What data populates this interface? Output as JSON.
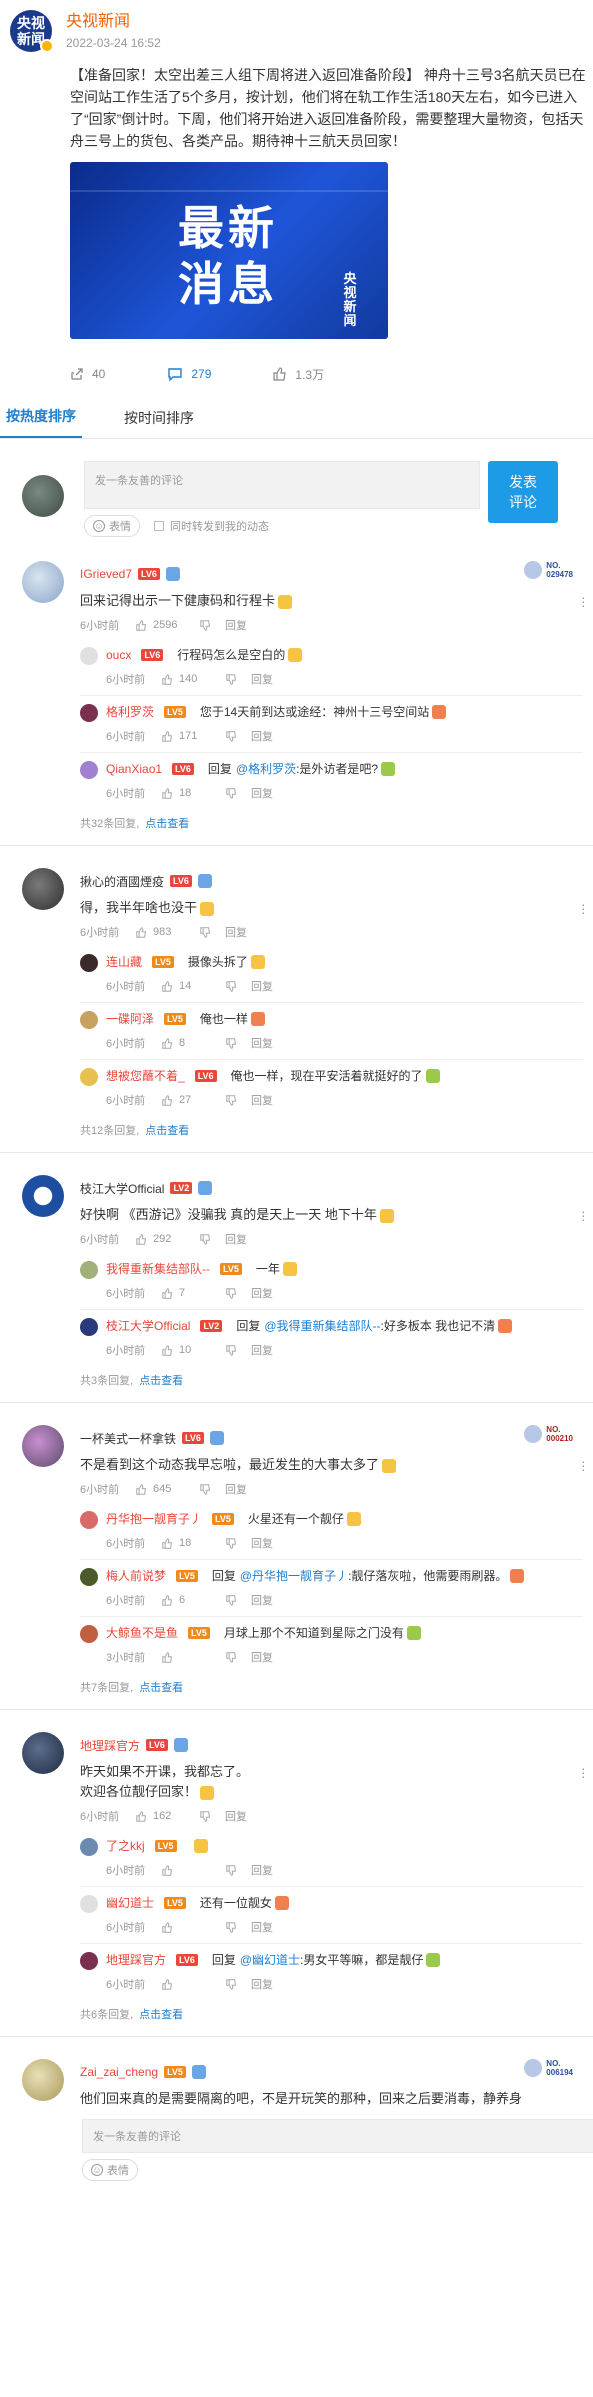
{
  "post": {
    "avatar_text": "央视\n新闻",
    "author": "央视新闻",
    "time": "2022-03-24 16:52",
    "text": "【准备回家！太空出差三人组下周将进入返回准备阶段】 神舟十三号3名航天员已在空间站工作生活了5个多月，按计划，他们将在轨工作生活180天左右，如今已进入了“回家”倒计时。下周，他们将开始进入返回准备阶段，需要整理大量物资，包括天舟三号上的货包、各类产品。期待神十三航天员回家！",
    "image_text": "最新\n消息",
    "image_logo": "央视新闻",
    "actions": [
      {
        "icon": "share-icon",
        "count": "40"
      },
      {
        "icon": "comment-icon",
        "count": "279"
      },
      {
        "icon": "like-icon",
        "count": "1.3万"
      }
    ]
  },
  "tabs": [
    "按热度排序",
    "按时间排序"
  ],
  "composer": {
    "placeholder": "发一条友善的评论",
    "emoji_label": "表情",
    "forward_label": "同时转发到我的动态",
    "send_label": "发表\n评论"
  },
  "comments": [
    {
      "name": "IGrieved7",
      "name_color": "red",
      "level": "LV6",
      "badge": "NO.\n029478",
      "text": "回来记得出示一下健康码和行程卡",
      "emoji": true,
      "time": "6小时前",
      "likes": "2596",
      "reply_label": "回复",
      "replies": [
        {
          "name": "oucx",
          "level": "LV6",
          "text": "行程码怎么是空白的",
          "time": "6小时前",
          "likes": "140"
        },
        {
          "name": "格利罗茨",
          "level": "LV5",
          "text": "您于14天前到达或途经：神州十三号空间站",
          "time": "6小时前",
          "likes": "171"
        },
        {
          "name": "QianXiao1",
          "level": "LV6",
          "prefix": "回复",
          "at": "@格利罗茨",
          "text": ":是外访者是吧?",
          "time": "6小时前",
          "likes": "18"
        }
      ],
      "more": "共32条回复,",
      "more_link": "点击查看"
    },
    {
      "name": "揪心的酒國煙疫",
      "name_color": "",
      "level": "LV6",
      "badge": "",
      "text": "得，我半年啥也没干",
      "emoji": true,
      "time": "6小时前",
      "likes": "983",
      "reply_label": "回复",
      "replies": [
        {
          "name": "连山藏",
          "level": "LV5",
          "text": "摄像头拆了",
          "time": "6小时前",
          "likes": "14"
        },
        {
          "name": "一碟阿泽",
          "level": "LV5",
          "text": "俺也一样",
          "time": "6小时前",
          "likes": "8"
        },
        {
          "name": "想被您蘸不着_",
          "level": "LV6",
          "text": "俺也一样，现在平安活着就挺好的了",
          "time": "6小时前",
          "likes": "27"
        }
      ],
      "more": "共12条回复,",
      "more_link": "点击查看"
    },
    {
      "name": "枝江大学Official",
      "name_color": "",
      "level": "LV2",
      "badge": "",
      "text": "好快啊 《西游记》没骗我 真的是天上一天 地下十年",
      "emoji": true,
      "time": "6小时前",
      "likes": "292",
      "reply_label": "回复",
      "replies": [
        {
          "name": "我得重新集结部队--",
          "level": "LV5",
          "text": "一年",
          "time": "6小时前",
          "likes": "7"
        },
        {
          "name": "枝江大学Official",
          "level": "LV2",
          "prefix": "回复",
          "at": "@我得重新集结部队--",
          "text": ":好多板本 我也记不清",
          "time": "6小时前",
          "likes": "10"
        }
      ],
      "more": "共3条回复,",
      "more_link": "点击查看"
    },
    {
      "name": "一杯美式一杯拿铁",
      "name_color": "",
      "level": "LV6",
      "badge": "NO.\n000210",
      "text": "不是看到这个动态我早忘啦，最近发生的大事太多了",
      "emoji": true,
      "time": "6小时前",
      "likes": "645",
      "reply_label": "回复",
      "replies": [
        {
          "name": "丹华抱一靓育子丿",
          "level": "LV5",
          "text": "火星还有一个靓仔",
          "time": "6小时前",
          "likes": "18"
        },
        {
          "name": "梅人前说梦",
          "level": "LV5",
          "prefix": "回复",
          "at": "@丹华抱一靓育子丿",
          "text": ":靓仔落灰啦，他需要雨刷器。",
          "time": "6小时前",
          "likes": "6"
        },
        {
          "name": "大鲸鱼不是鱼",
          "level": "LV5",
          "text": "月球上那个不知道到星际之门没有",
          "time": "3小时前",
          "likes": ""
        }
      ],
      "more": "共7条回复,",
      "more_link": "点击查看"
    },
    {
      "name": "地理踩官方",
      "name_color": "red",
      "level": "LV6",
      "badge": "",
      "text": "昨天如果不开课，我都忘了。\n欢迎各位靓仔回家！",
      "emoji": true,
      "time": "6小时前",
      "likes": "162",
      "reply_label": "回复",
      "replies": [
        {
          "name": "了之kkj",
          "level": "LV5",
          "text": "",
          "time": "6小时前",
          "likes": ""
        },
        {
          "name": "幽幻道士",
          "level": "LV5",
          "text": "还有一位靓女",
          "time": "6小时前",
          "likes": ""
        },
        {
          "name": "地理踩官方",
          "level": "LV6",
          "prefix": "回复",
          "at": "@幽幻道士",
          "text": ":男女平等嘛，都是靓仔",
          "time": "6小时前",
          "likes": ""
        }
      ],
      "more": "共6条回复,",
      "more_link": "点击查看"
    },
    {
      "name": "Zai_zai_cheng",
      "name_color": "red",
      "level": "LV5",
      "badge": "NO.\n006194",
      "text": "他们回来真的是需要隔离的吧，不是开玩笑的那种，回来之后要消毒，静养身",
      "emoji": false,
      "time": "",
      "likes": "",
      "reply_label": "",
      "replies": [],
      "more": "",
      "more_link": ""
    }
  ],
  "bottom_composer": {
    "placeholder": "发一条友善的评论",
    "emoji_label": "表情"
  }
}
